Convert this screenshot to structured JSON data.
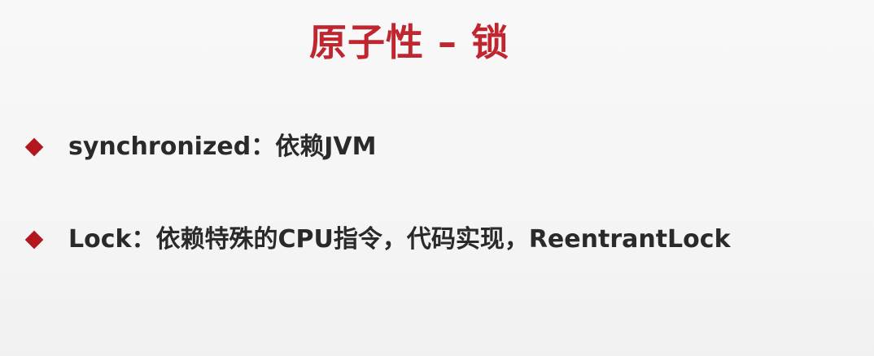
{
  "slide": {
    "title": "原子性 – 锁",
    "bullets": [
      {
        "icon": "diamond-bullet",
        "text": "synchronized：依赖JVM"
      },
      {
        "icon": "diamond-bullet",
        "text": "Lock：依赖特殊的CPU指令，代码实现，ReentrantLock"
      }
    ]
  },
  "colors": {
    "title": "#c0262f",
    "bullet": "#b4161d",
    "text": "#2a2a2a",
    "background": "#f6f6f6"
  }
}
